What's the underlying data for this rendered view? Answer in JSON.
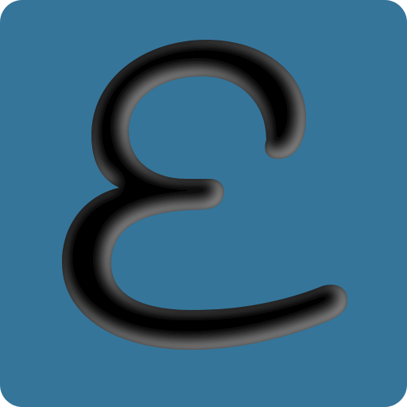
{
  "app_icon": {
    "name": "epsilon-app-icon",
    "glyph": "ε",
    "colors": {
      "background": "#35759a",
      "glyph": "#000000",
      "glyph_highlight": "#9a9a9a"
    }
  }
}
